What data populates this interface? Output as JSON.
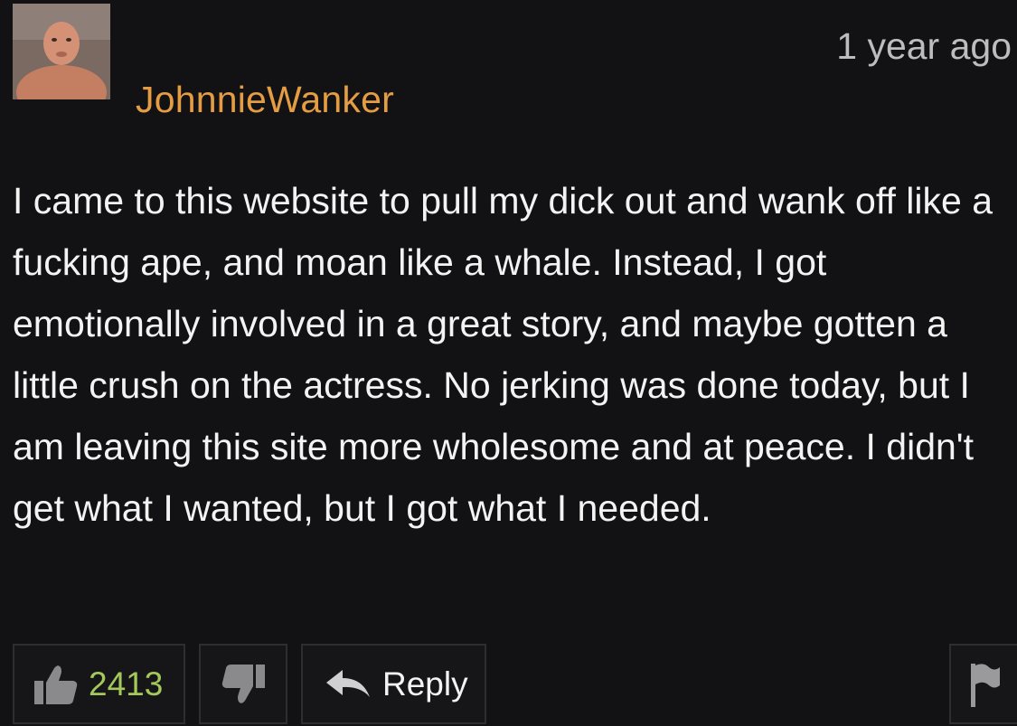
{
  "comment": {
    "username": "JohnnieWanker",
    "timestamp": "1 year ago",
    "text": "I came to this website to pull my dick out and wank off like a fucking ape, and moan like a whale. Instead, I got emotionally involved in a great story, and maybe gotten a little crush on the actress. No jerking was done today, but I am leaving this site more wholesome and at peace. I didn't get what I wanted, but I got what I needed."
  },
  "actions": {
    "like_count": "2413",
    "reply_label": "Reply"
  },
  "icons": {
    "like": "thumbs-up-icon",
    "dislike": "thumbs-down-icon",
    "reply": "reply-arrow-icon",
    "flag": "flag-icon"
  },
  "colors": {
    "background": "#121113",
    "username": "#e59d43",
    "timestamp": "#bdbdbd",
    "like_count": "#a4c85a",
    "text": "#f3f3f3"
  }
}
